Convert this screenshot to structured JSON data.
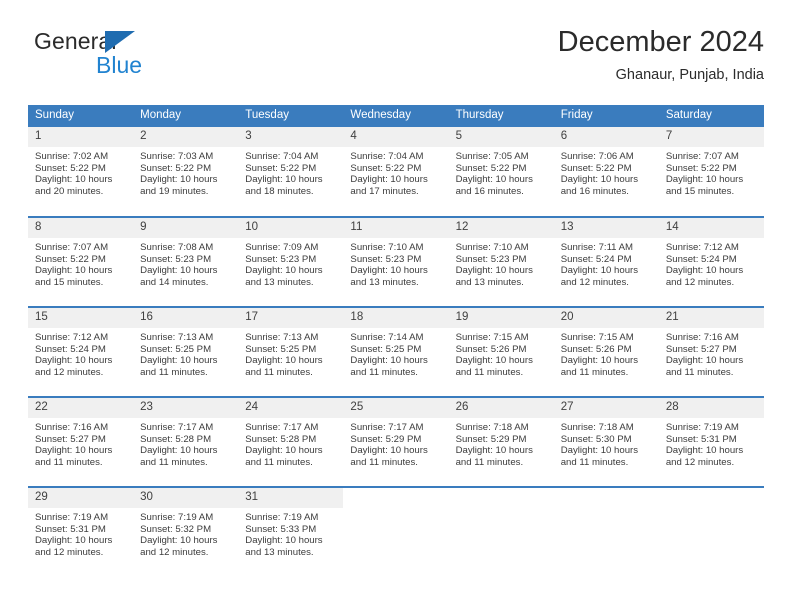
{
  "brand": {
    "name_top": "General",
    "name_bottom": "Blue",
    "triangle_color": "#1f6cb0",
    "blue_color": "#2183d0"
  },
  "header": {
    "title": "December 2024",
    "location": "Ghanaur, Punjab, India"
  },
  "theme": {
    "header_row_bg": "#3a7cbe",
    "header_row_text": "#ffffff",
    "daynum_bg": "#f0f0f0",
    "body_text": "#3c3c3c"
  },
  "calendar": {
    "weekday_headers": [
      "Sunday",
      "Monday",
      "Tuesday",
      "Wednesday",
      "Thursday",
      "Friday",
      "Saturday"
    ],
    "weeks": [
      [
        {
          "day": "1",
          "sunrise": "Sunrise: 7:02 AM",
          "sunset": "Sunset: 5:22 PM",
          "daylight1": "Daylight: 10 hours",
          "daylight2": "and 20 minutes."
        },
        {
          "day": "2",
          "sunrise": "Sunrise: 7:03 AM",
          "sunset": "Sunset: 5:22 PM",
          "daylight1": "Daylight: 10 hours",
          "daylight2": "and 19 minutes."
        },
        {
          "day": "3",
          "sunrise": "Sunrise: 7:04 AM",
          "sunset": "Sunset: 5:22 PM",
          "daylight1": "Daylight: 10 hours",
          "daylight2": "and 18 minutes."
        },
        {
          "day": "4",
          "sunrise": "Sunrise: 7:04 AM",
          "sunset": "Sunset: 5:22 PM",
          "daylight1": "Daylight: 10 hours",
          "daylight2": "and 17 minutes."
        },
        {
          "day": "5",
          "sunrise": "Sunrise: 7:05 AM",
          "sunset": "Sunset: 5:22 PM",
          "daylight1": "Daylight: 10 hours",
          "daylight2": "and 16 minutes."
        },
        {
          "day": "6",
          "sunrise": "Sunrise: 7:06 AM",
          "sunset": "Sunset: 5:22 PM",
          "daylight1": "Daylight: 10 hours",
          "daylight2": "and 16 minutes."
        },
        {
          "day": "7",
          "sunrise": "Sunrise: 7:07 AM",
          "sunset": "Sunset: 5:22 PM",
          "daylight1": "Daylight: 10 hours",
          "daylight2": "and 15 minutes."
        }
      ],
      [
        {
          "day": "8",
          "sunrise": "Sunrise: 7:07 AM",
          "sunset": "Sunset: 5:22 PM",
          "daylight1": "Daylight: 10 hours",
          "daylight2": "and 15 minutes."
        },
        {
          "day": "9",
          "sunrise": "Sunrise: 7:08 AM",
          "sunset": "Sunset: 5:23 PM",
          "daylight1": "Daylight: 10 hours",
          "daylight2": "and 14 minutes."
        },
        {
          "day": "10",
          "sunrise": "Sunrise: 7:09 AM",
          "sunset": "Sunset: 5:23 PM",
          "daylight1": "Daylight: 10 hours",
          "daylight2": "and 13 minutes."
        },
        {
          "day": "11",
          "sunrise": "Sunrise: 7:10 AM",
          "sunset": "Sunset: 5:23 PM",
          "daylight1": "Daylight: 10 hours",
          "daylight2": "and 13 minutes."
        },
        {
          "day": "12",
          "sunrise": "Sunrise: 7:10 AM",
          "sunset": "Sunset: 5:23 PM",
          "daylight1": "Daylight: 10 hours",
          "daylight2": "and 13 minutes."
        },
        {
          "day": "13",
          "sunrise": "Sunrise: 7:11 AM",
          "sunset": "Sunset: 5:24 PM",
          "daylight1": "Daylight: 10 hours",
          "daylight2": "and 12 minutes."
        },
        {
          "day": "14",
          "sunrise": "Sunrise: 7:12 AM",
          "sunset": "Sunset: 5:24 PM",
          "daylight1": "Daylight: 10 hours",
          "daylight2": "and 12 minutes."
        }
      ],
      [
        {
          "day": "15",
          "sunrise": "Sunrise: 7:12 AM",
          "sunset": "Sunset: 5:24 PM",
          "daylight1": "Daylight: 10 hours",
          "daylight2": "and 12 minutes."
        },
        {
          "day": "16",
          "sunrise": "Sunrise: 7:13 AM",
          "sunset": "Sunset: 5:25 PM",
          "daylight1": "Daylight: 10 hours",
          "daylight2": "and 11 minutes."
        },
        {
          "day": "17",
          "sunrise": "Sunrise: 7:13 AM",
          "sunset": "Sunset: 5:25 PM",
          "daylight1": "Daylight: 10 hours",
          "daylight2": "and 11 minutes."
        },
        {
          "day": "18",
          "sunrise": "Sunrise: 7:14 AM",
          "sunset": "Sunset: 5:25 PM",
          "daylight1": "Daylight: 10 hours",
          "daylight2": "and 11 minutes."
        },
        {
          "day": "19",
          "sunrise": "Sunrise: 7:15 AM",
          "sunset": "Sunset: 5:26 PM",
          "daylight1": "Daylight: 10 hours",
          "daylight2": "and 11 minutes."
        },
        {
          "day": "20",
          "sunrise": "Sunrise: 7:15 AM",
          "sunset": "Sunset: 5:26 PM",
          "daylight1": "Daylight: 10 hours",
          "daylight2": "and 11 minutes."
        },
        {
          "day": "21",
          "sunrise": "Sunrise: 7:16 AM",
          "sunset": "Sunset: 5:27 PM",
          "daylight1": "Daylight: 10 hours",
          "daylight2": "and 11 minutes."
        }
      ],
      [
        {
          "day": "22",
          "sunrise": "Sunrise: 7:16 AM",
          "sunset": "Sunset: 5:27 PM",
          "daylight1": "Daylight: 10 hours",
          "daylight2": "and 11 minutes."
        },
        {
          "day": "23",
          "sunrise": "Sunrise: 7:17 AM",
          "sunset": "Sunset: 5:28 PM",
          "daylight1": "Daylight: 10 hours",
          "daylight2": "and 11 minutes."
        },
        {
          "day": "24",
          "sunrise": "Sunrise: 7:17 AM",
          "sunset": "Sunset: 5:28 PM",
          "daylight1": "Daylight: 10 hours",
          "daylight2": "and 11 minutes."
        },
        {
          "day": "25",
          "sunrise": "Sunrise: 7:17 AM",
          "sunset": "Sunset: 5:29 PM",
          "daylight1": "Daylight: 10 hours",
          "daylight2": "and 11 minutes."
        },
        {
          "day": "26",
          "sunrise": "Sunrise: 7:18 AM",
          "sunset": "Sunset: 5:29 PM",
          "daylight1": "Daylight: 10 hours",
          "daylight2": "and 11 minutes."
        },
        {
          "day": "27",
          "sunrise": "Sunrise: 7:18 AM",
          "sunset": "Sunset: 5:30 PM",
          "daylight1": "Daylight: 10 hours",
          "daylight2": "and 11 minutes."
        },
        {
          "day": "28",
          "sunrise": "Sunrise: 7:19 AM",
          "sunset": "Sunset: 5:31 PM",
          "daylight1": "Daylight: 10 hours",
          "daylight2": "and 12 minutes."
        }
      ],
      [
        {
          "day": "29",
          "sunrise": "Sunrise: 7:19 AM",
          "sunset": "Sunset: 5:31 PM",
          "daylight1": "Daylight: 10 hours",
          "daylight2": "and 12 minutes."
        },
        {
          "day": "30",
          "sunrise": "Sunrise: 7:19 AM",
          "sunset": "Sunset: 5:32 PM",
          "daylight1": "Daylight: 10 hours",
          "daylight2": "and 12 minutes."
        },
        {
          "day": "31",
          "sunrise": "Sunrise: 7:19 AM",
          "sunset": "Sunset: 5:33 PM",
          "daylight1": "Daylight: 10 hours",
          "daylight2": "and 13 minutes."
        },
        {
          "day": "",
          "sunrise": "",
          "sunset": "",
          "daylight1": "",
          "daylight2": ""
        },
        {
          "day": "",
          "sunrise": "",
          "sunset": "",
          "daylight1": "",
          "daylight2": ""
        },
        {
          "day": "",
          "sunrise": "",
          "sunset": "",
          "daylight1": "",
          "daylight2": ""
        },
        {
          "day": "",
          "sunrise": "",
          "sunset": "",
          "daylight1": "",
          "daylight2": ""
        }
      ]
    ]
  }
}
